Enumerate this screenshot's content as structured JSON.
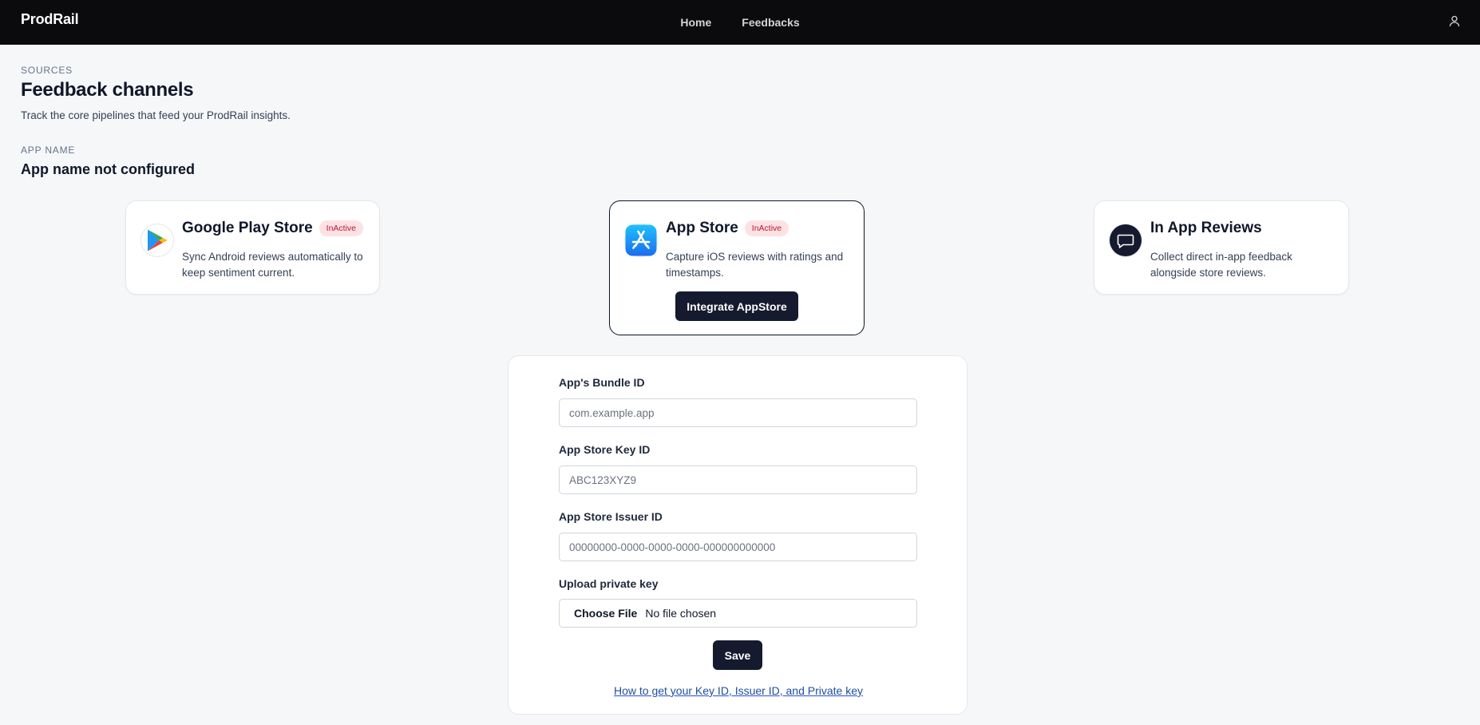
{
  "nav": {
    "brand": "ProdRail",
    "links": [
      "Home",
      "Feedbacks"
    ],
    "user_icon": "user-icon"
  },
  "header": {
    "eyebrow": "SOURCES",
    "title": "Feedback channels",
    "subtitle": "Track the core pipelines that feed your ProdRail insights."
  },
  "app": {
    "label": "APP NAME",
    "value": "App name not configured"
  },
  "cards": [
    {
      "title": "Google Play Store",
      "badge": "InActive",
      "description": "Sync Android reviews automatically to keep sentiment current.",
      "icon": "google-play-icon"
    },
    {
      "title": "App Store",
      "badge": "InActive",
      "description": "Capture iOS reviews with ratings and timestamps.",
      "action": "Integrate AppStore",
      "icon": "app-store-icon"
    },
    {
      "title": "In App Reviews",
      "description": "Collect direct in-app feedback alongside store reviews.",
      "icon": "chat-bubble-icon"
    }
  ],
  "form": {
    "bundle_label": "App's Bundle ID",
    "bundle_placeholder": "com.example.app",
    "key_label": "App Store Key ID",
    "key_placeholder": "ABC123XYZ9",
    "issuer_label": "App Store Issuer ID",
    "issuer_placeholder": "00000000-0000-0000-0000-000000000000",
    "upload_label": "Upload private key",
    "file_button": "Choose File",
    "file_status": "No file chosen",
    "save": "Save",
    "help_link": "How to get your Key ID, Issuer ID, and Private key"
  },
  "colors": {
    "nav_bg": "#0b0b0d",
    "page_bg": "#f6f7f9",
    "badge_bg": "#fde2e4",
    "badge_text": "#be123c",
    "button_dark": "#151a2e",
    "link": "#1f4e9a"
  }
}
